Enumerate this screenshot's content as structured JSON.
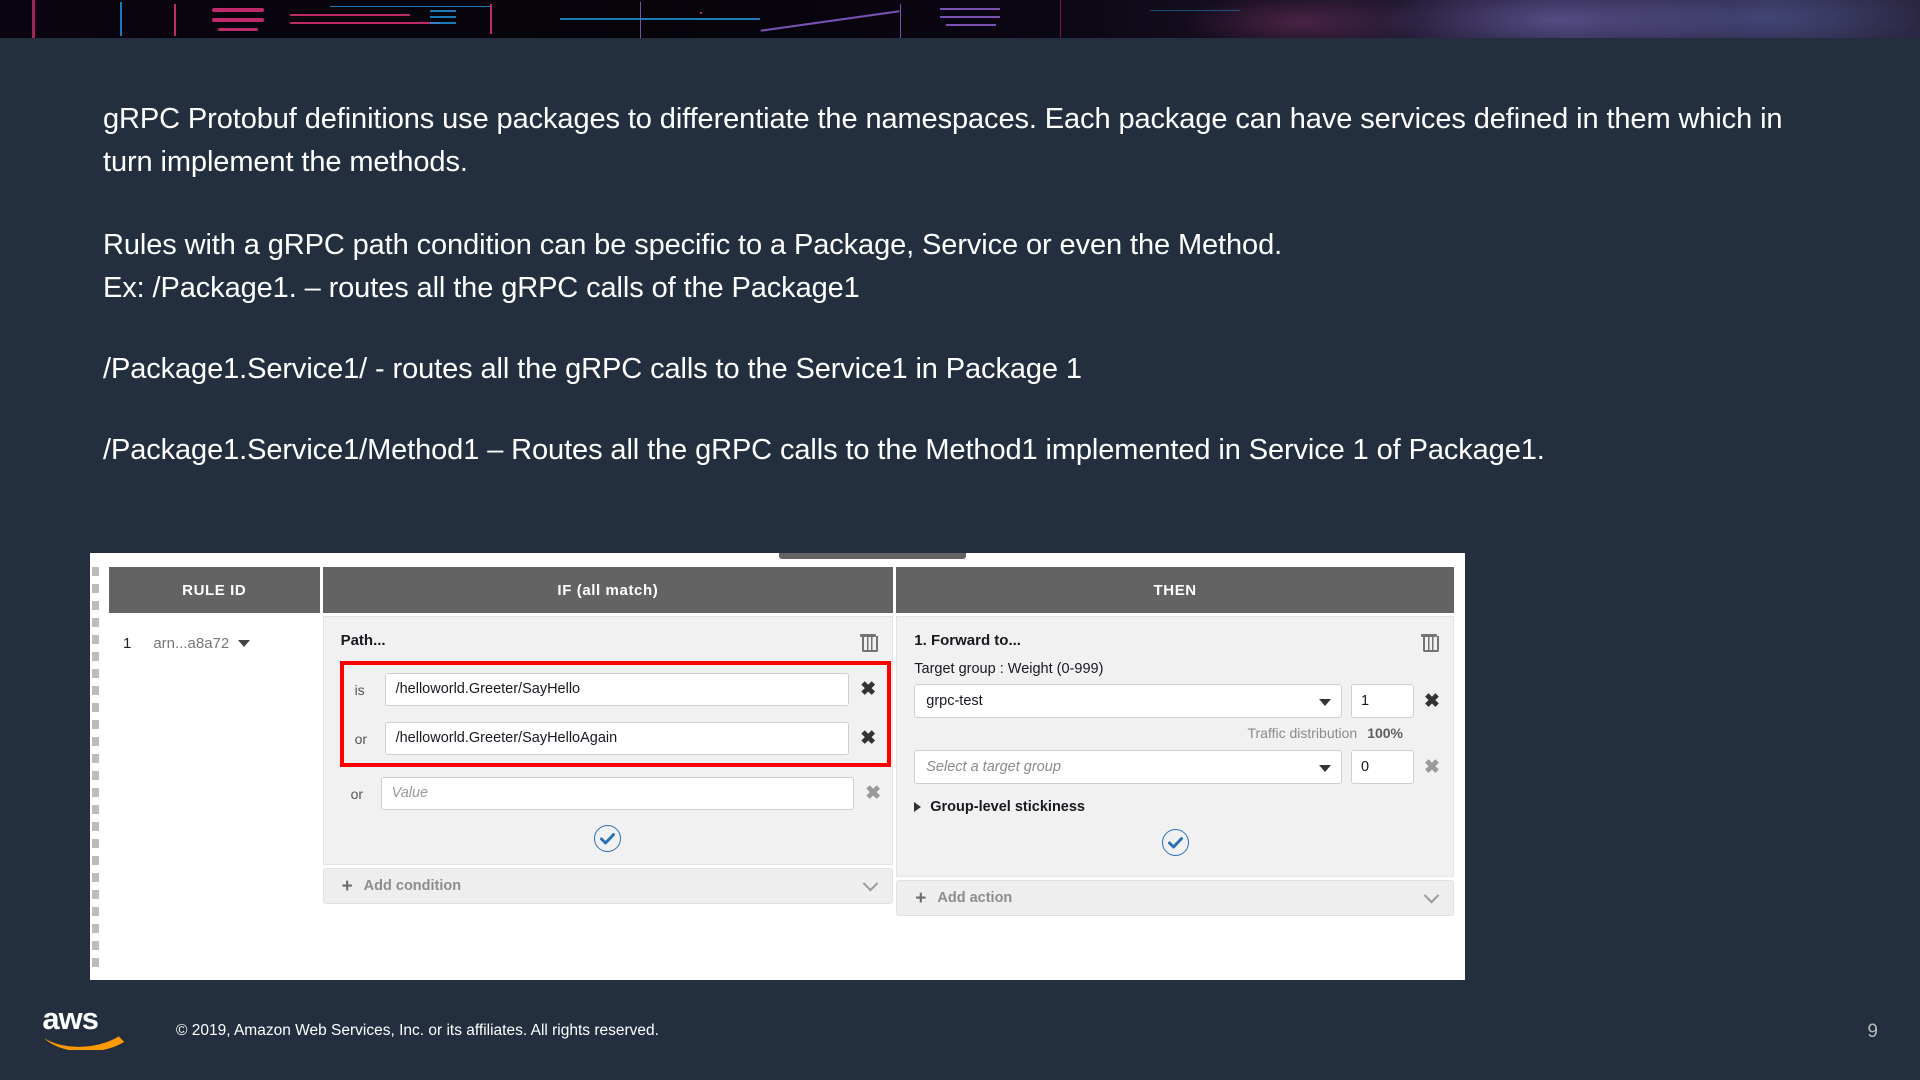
{
  "slide": {
    "page_number": "9",
    "paragraphs": [
      "gRPC Protobuf definitions use packages to differentiate the namespaces. Each package can have services defined in them which in turn implement the methods.",
      "Rules with a gRPC path condition can be specific to a Package, Service or even the Method.\nEx: /Package1. – routes all the gRPC calls of the Package1",
      "/Package1.Service1/ - routes all the gRPC calls to the Service1 in Package 1",
      "/Package1.Service1/Method1 – Routes all the gRPC calls to the Method1 implemented in Service 1 of Package1."
    ],
    "footer": {
      "logo_text": "aws",
      "copyright": "© 2019, Amazon Web Services, Inc. or its affiliates. All rights reserved."
    }
  },
  "console": {
    "headers": {
      "rule_id": "RULE ID",
      "if": "IF (all match)",
      "then": "THEN"
    },
    "rule": {
      "number": "1",
      "arn": "arn...a8a72"
    },
    "if_panel": {
      "title": "Path...",
      "conditions": [
        {
          "operator": "is",
          "value": "/helloworld.Greeter/SayHello",
          "placeholder": "Value",
          "highlighted": true
        },
        {
          "operator": "or",
          "value": "/helloworld.Greeter/SayHelloAgain",
          "placeholder": "Value",
          "highlighted": true
        },
        {
          "operator": "or",
          "value": "",
          "placeholder": "Value",
          "highlighted": false
        }
      ],
      "add_condition_label": "Add condition"
    },
    "then_panel": {
      "title": "1. Forward to...",
      "target_group_label": "Target group : Weight (0-999)",
      "targets": [
        {
          "group": "grpc-test",
          "group_placeholder": "Select a target group",
          "weight": "1"
        },
        {
          "group": "",
          "group_placeholder": "Select a target group",
          "weight": "0"
        }
      ],
      "traffic_label": "Traffic distribution",
      "traffic_value": "100%",
      "stickiness_label": "Group-level stickiness",
      "add_action_label": "Add action"
    }
  },
  "colors": {
    "slide_bg": "#232f3e",
    "highlight_red": "#ff0000",
    "aws_orange": "#ff9900",
    "accent_blue": "#2a6fb8",
    "header_grey": "#636363"
  }
}
